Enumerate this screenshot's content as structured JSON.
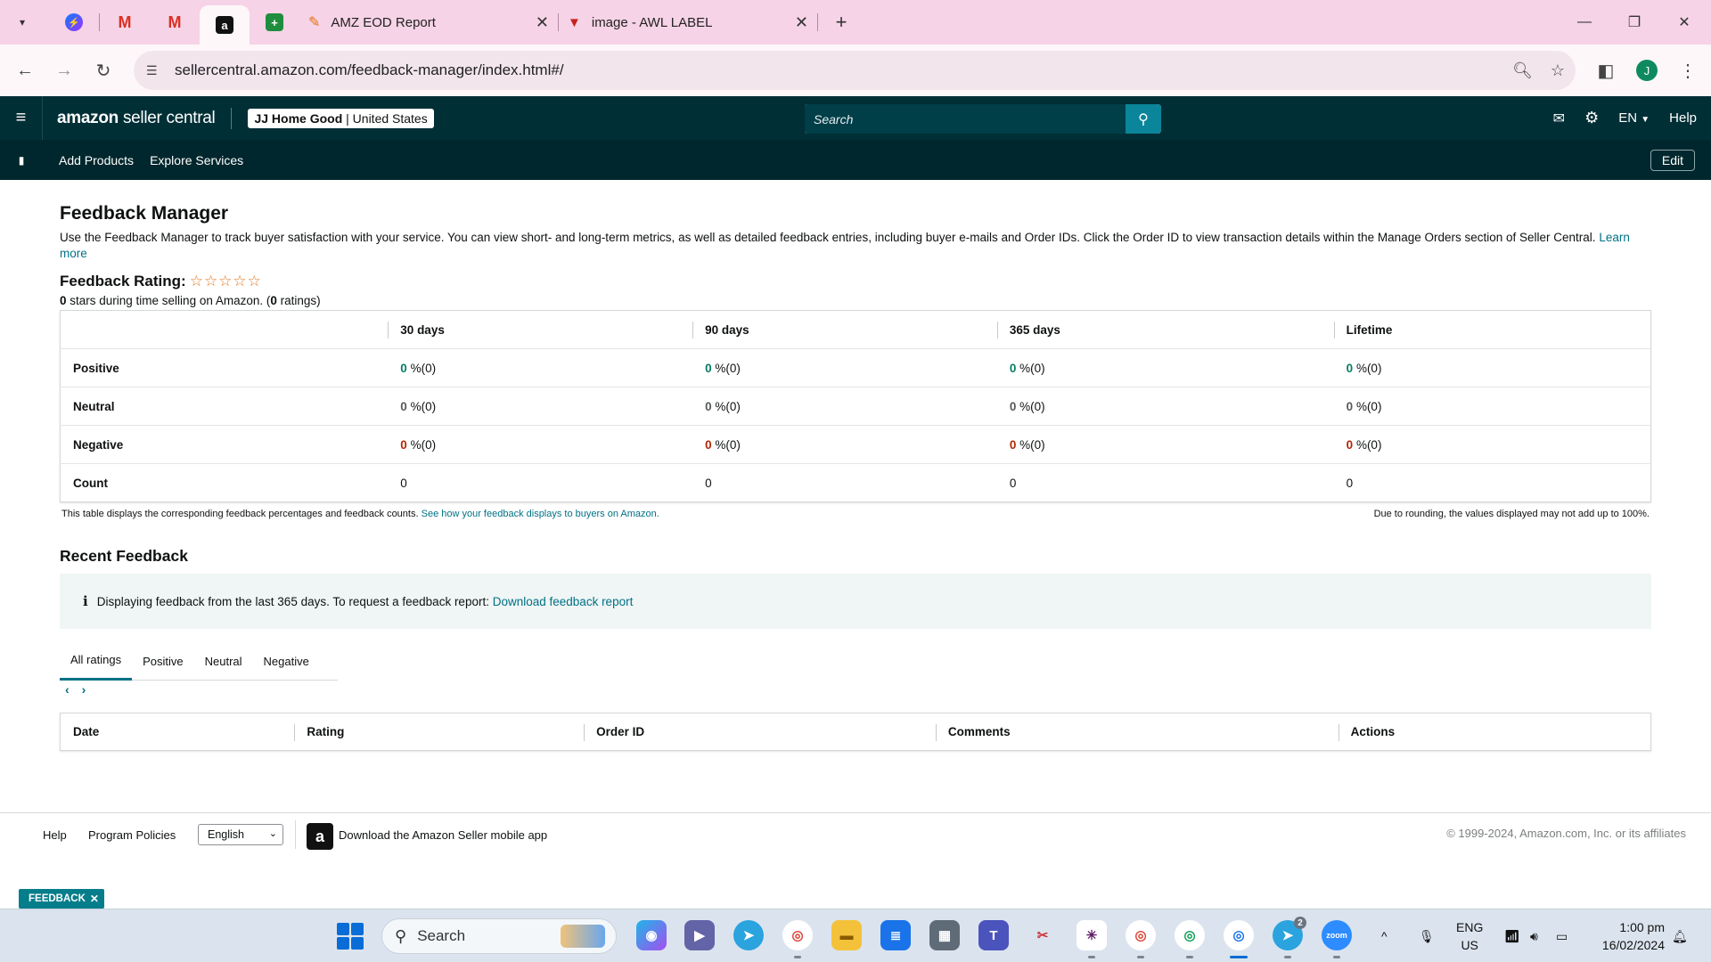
{
  "browser": {
    "tabs": [
      {
        "title": "AMZ EOD Report",
        "favicon": "pen-icon"
      },
      {
        "title": "image - AWL LABEL",
        "favicon": "awl-icon"
      }
    ],
    "pinned": [
      "messenger-icon",
      "gmail-icon",
      "gmail-icon",
      "amazon-icon",
      "sheets-icon"
    ],
    "url": "sellercentral.amazon.com/feedback-manager/index.html#/",
    "profile_initial": "J"
  },
  "header": {
    "logo": {
      "brand": "amazon",
      "product": "seller central"
    },
    "account": {
      "store": "JJ Home Good",
      "marketplace": "United States"
    },
    "search_placeholder": "Search",
    "language": "EN",
    "help": "Help"
  },
  "subnav": {
    "links": [
      "Add Products",
      "Explore Services"
    ],
    "edit": "Edit"
  },
  "page": {
    "title": "Feedback Manager",
    "intro": "Use the Feedback Manager to track buyer satisfaction with your service. You can view short- and long-term metrics, as well as detailed feedback entries, including buyer e-mails and Order IDs. Click the Order ID to view transaction details within the Manage Orders section of Seller Central.",
    "learn_more": "Learn more",
    "rating_label": "Feedback Rating:",
    "stars": "☆☆☆☆☆",
    "stars_count": "0",
    "stars_text": " stars during time selling on Amazon. (",
    "ratings_count": "0",
    "ratings_text": " ratings)"
  },
  "feedback_table": {
    "columns": [
      "30 days",
      "90 days",
      "365 days",
      "Lifetime"
    ],
    "rows": [
      {
        "label": "Positive",
        "cells": [
          [
            "0",
            "%(0)"
          ],
          [
            "0",
            "%(0)"
          ],
          [
            "0",
            "%(0)"
          ],
          [
            "0",
            "%(0)"
          ]
        ]
      },
      {
        "label": "Neutral",
        "cells": [
          [
            "0",
            "%(0)"
          ],
          [
            "0",
            "%(0)"
          ],
          [
            "0",
            "%(0)"
          ],
          [
            "0",
            "%(0)"
          ]
        ]
      },
      {
        "label": "Negative",
        "cells": [
          [
            "0",
            "%(0)"
          ],
          [
            "0",
            "%(0)"
          ],
          [
            "0",
            "%(0)"
          ],
          [
            "0",
            "%(0)"
          ]
        ]
      },
      {
        "label": "Count",
        "cells": [
          [
            "0",
            ""
          ],
          [
            "0",
            ""
          ],
          [
            "0",
            ""
          ],
          [
            "0",
            ""
          ]
        ]
      }
    ],
    "note": "This table displays the corresponding feedback percentages and feedback counts.",
    "note_link": "See how your feedback displays to buyers on Amazon.",
    "rounding_note": "Due to rounding, the values displayed may not add up to 100%."
  },
  "recent": {
    "title": "Recent Feedback",
    "info": "Displaying feedback from the last 365 days. To request a feedback report:",
    "download_link": "Download feedback report",
    "tabs": [
      "All ratings",
      "Positive",
      "Neutral",
      "Negative"
    ],
    "active_tab": "All ratings",
    "columns": [
      "Date",
      "Rating",
      "Order ID",
      "Comments",
      "Actions"
    ]
  },
  "footer": {
    "help": "Help",
    "policies": "Program Policies",
    "language": "English",
    "app_text": "Download the Amazon Seller mobile app",
    "copyright": "© 1999-2024, Amazon.com, Inc. or its affiliates"
  },
  "feedback_pill": "FEEDBACK",
  "taskbar": {
    "search": "Search",
    "lang_line1": "ENG",
    "lang_line2": "US",
    "time": "1:00 pm",
    "date": "16/02/2024",
    "telegram_badge": "2"
  },
  "colors": {
    "header_bg": "#002f36",
    "accent_teal": "#007185",
    "positive_green": "#067d62",
    "negative_red": "#b12704",
    "star_orange": "#de7921"
  }
}
